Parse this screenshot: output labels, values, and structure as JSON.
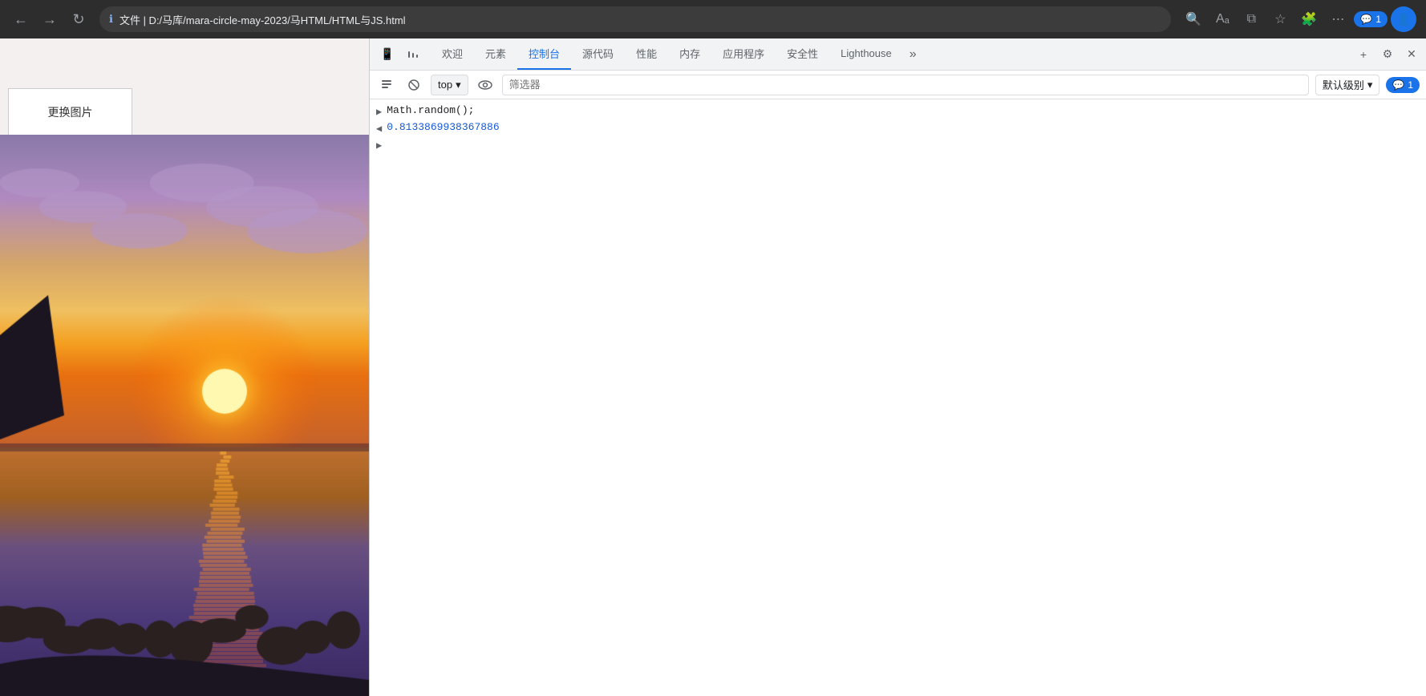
{
  "browser": {
    "back_label": "←",
    "forward_label": "→",
    "reload_label": "↻",
    "address": "文件  |  D:/马库/mara-circle-may-2023/马HTML/HTML与JS.html",
    "zoom_label": "🔍",
    "split_label": "⧉",
    "extensions_label": "🧩",
    "favorites_label": "☆",
    "settings_label": "⋯",
    "new_tab_label": "+",
    "tab_count": "1",
    "profile_label": "👤"
  },
  "devtools": {
    "tabs": [
      {
        "id": "device",
        "label": "📱",
        "icon": true
      },
      {
        "id": "network-throttle",
        "label": "⋯",
        "icon": true
      },
      {
        "id": "welcome",
        "label": "欢迎"
      },
      {
        "id": "elements",
        "label": "元素"
      },
      {
        "id": "console",
        "label": "控制台",
        "active": true
      },
      {
        "id": "sources",
        "label": "源代码"
      },
      {
        "id": "performance",
        "label": "性能"
      },
      {
        "id": "memory",
        "label": "内存"
      },
      {
        "id": "application",
        "label": "应用程序"
      },
      {
        "id": "security",
        "label": "安全性"
      },
      {
        "id": "lighthouse",
        "label": "Lighthouse"
      }
    ],
    "more_label": "»",
    "add_label": "+",
    "settings_label": "⚙",
    "close_label": "✕"
  },
  "console_toolbar": {
    "clear_label": "🚫",
    "block_label": "⊘",
    "top_label": "top",
    "eye_label": "👁",
    "filter_placeholder": "筛选器",
    "level_label": "默认级别",
    "issue_count": "1",
    "issue_icon": "💬"
  },
  "console_lines": [
    {
      "type": "input",
      "arrow": "▶",
      "code": "Math.random();"
    },
    {
      "type": "output",
      "arrow": "◀",
      "value": "0.8133869938367886"
    },
    {
      "type": "prompt",
      "arrow": "▶",
      "code": ""
    }
  ],
  "page": {
    "button_text": "更换图片",
    "bg_color": "#c8b8d0"
  },
  "colors": {
    "active_tab": "#1a73e8",
    "return_value": "#1558d6",
    "toolbar_bg": "#f1f3f4"
  }
}
